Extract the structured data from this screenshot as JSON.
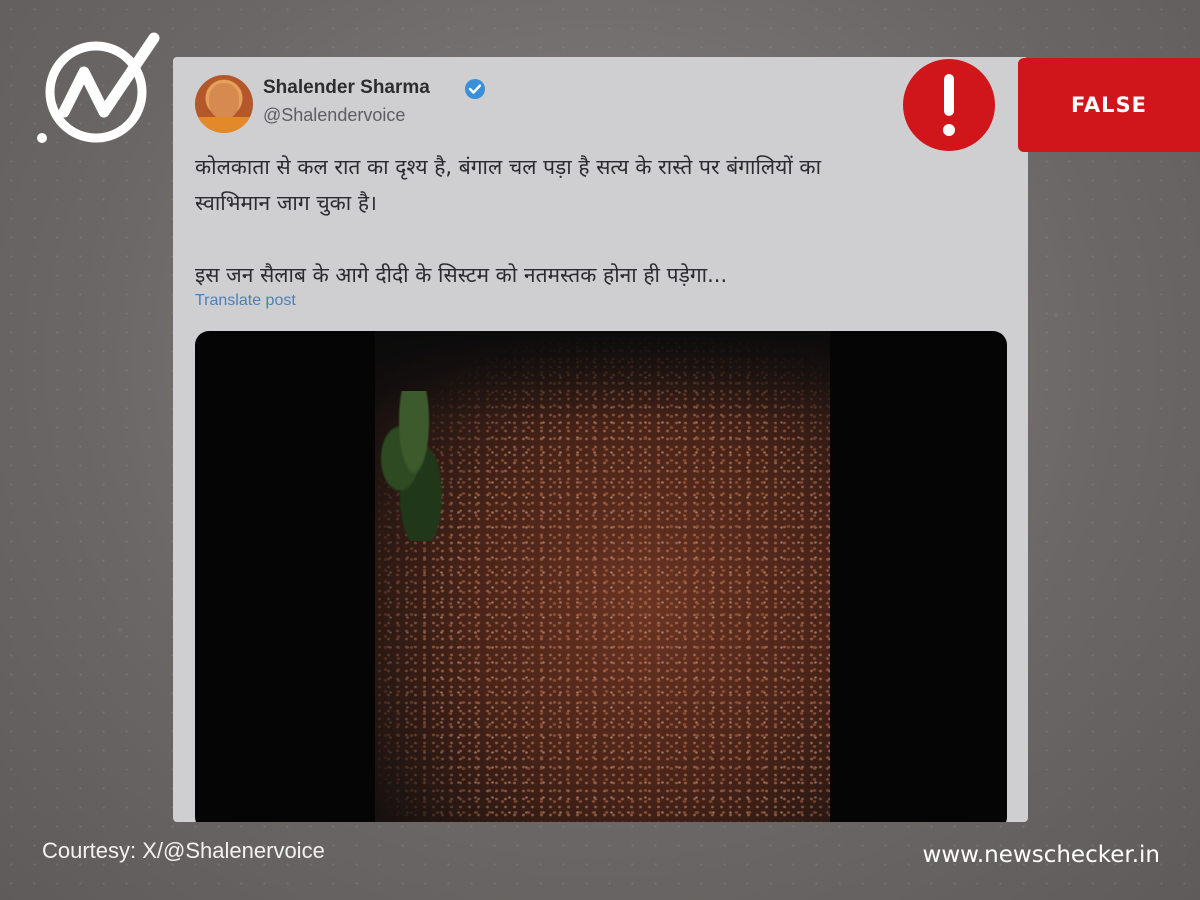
{
  "tweet": {
    "display_name": "Shalender Sharma",
    "handle": "@Shalendervoice",
    "verified": true,
    "more_icon": "more-dots-icon",
    "text_line_1": "कोलकाता से कल रात का दृश्य है, बंगाल चल पड़ा है सत्य के रास्ते पर बंगालियों का",
    "text_line_2": "स्वाभिमान जाग चुका है।",
    "text_line_3": "इस जन सैलाब के आगे दीदी के सिस्टम को नतमस्तक होना ही पड़ेगा...",
    "translate_label": "Translate post"
  },
  "badge": {
    "label": "FALSE",
    "color": "#d0161b",
    "warning_icon": "exclamation-circle-icon"
  },
  "footer": {
    "courtesy": "Courtesy: X/@Shalenervoice",
    "site_url": "www.newschecker.in"
  },
  "brand": {
    "logo_icon": "newschecker-logo-icon",
    "accent": "#d0161b"
  }
}
